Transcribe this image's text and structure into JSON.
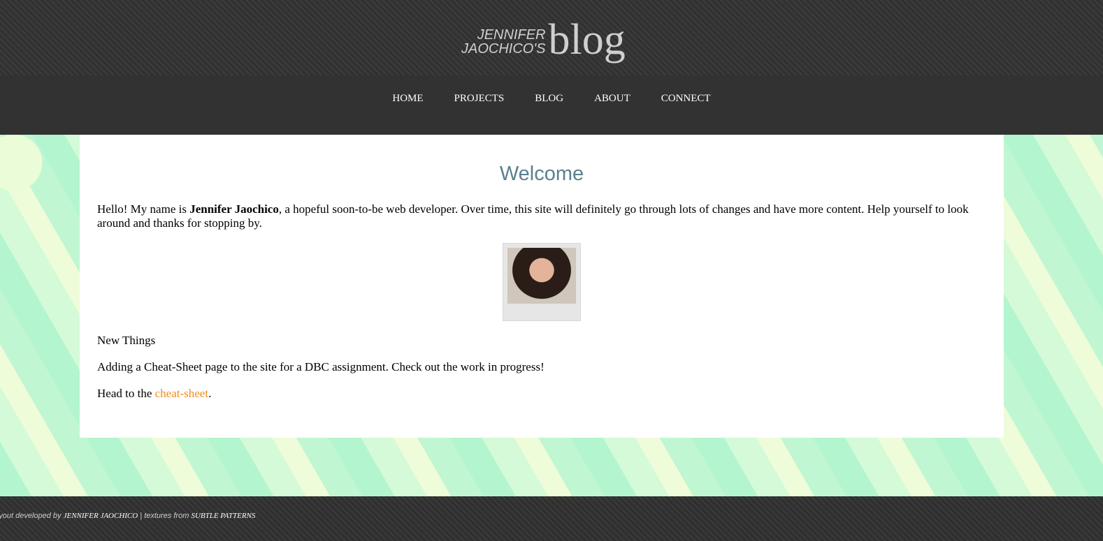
{
  "header": {
    "logo_small_line1": "JENNIFER",
    "logo_small_line2": "JAOCHICO'S",
    "logo_big": "blog"
  },
  "nav": [
    "HOME",
    "PROJECTS",
    "BLOG",
    "ABOUT",
    "CONNECT"
  ],
  "main": {
    "title": "Welcome",
    "intro_before": "Hello! My name is ",
    "intro_name": "Jennifer Jaochico",
    "intro_after": ", a hopeful soon-to-be web developer. Over time, this site will definitely go through lots of changes and have more content. Help yourself to look around and thanks for stopping by.",
    "section": "New Things",
    "news": "Adding a Cheat-Sheet page to the site for a DBC assignment. Check out the work in progress!",
    "head_to": "Head to the ",
    "link": "cheat-sheet",
    "period": "."
  },
  "footer": {
    "prefix": "Layout developed by ",
    "author": "JENNIFER JAOCHICO",
    "mid": " | textures from ",
    "credit": "SUBTLE PATTERNS"
  }
}
